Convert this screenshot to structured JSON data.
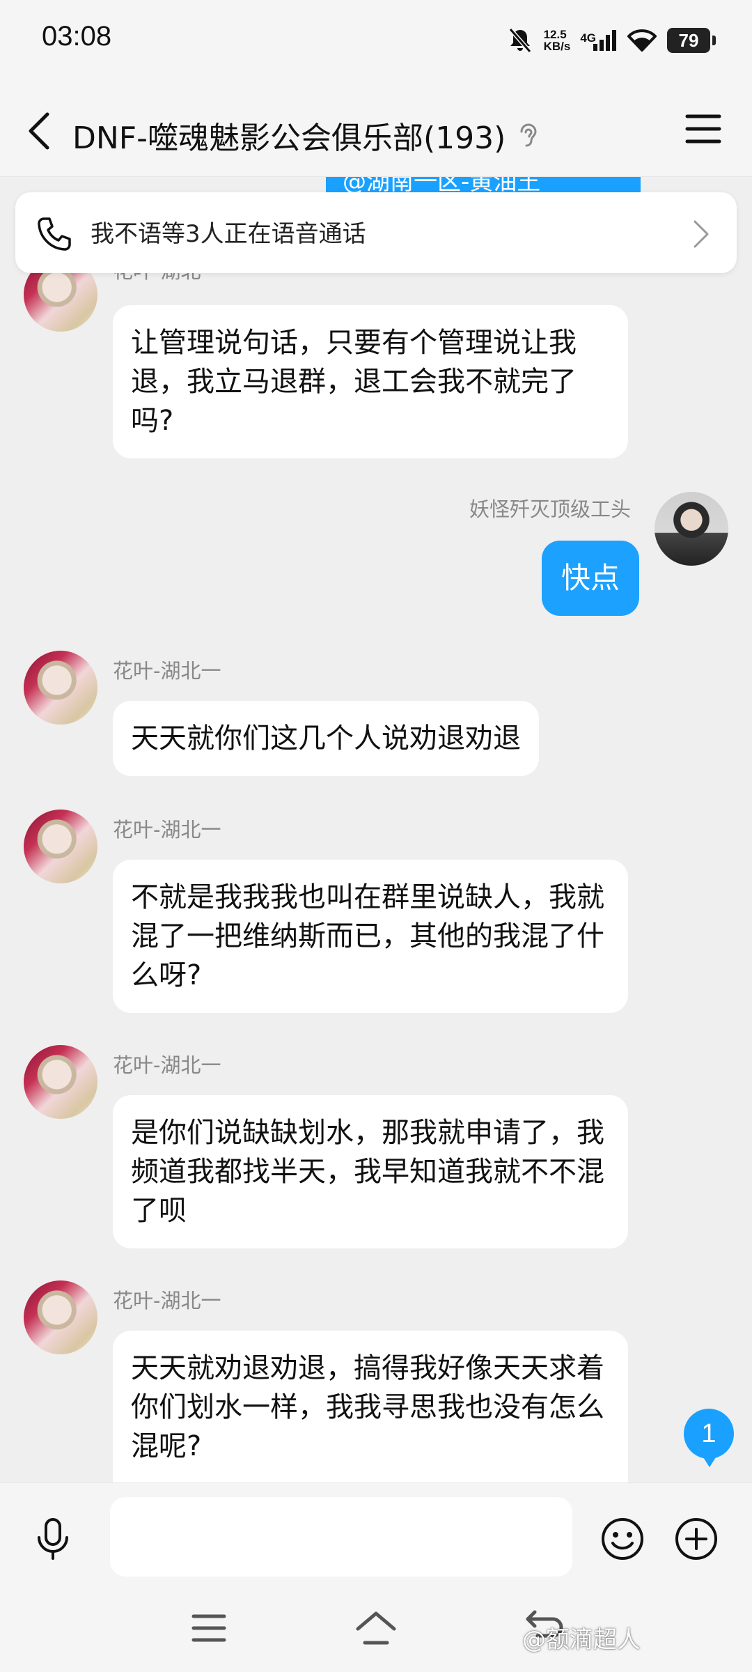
{
  "status_bar": {
    "time": "03:08",
    "speed_value": "12.5",
    "speed_unit": "KB/s",
    "network": "4G",
    "battery": "79"
  },
  "header": {
    "title": "DNF-噬魂魅影公会俱乐部(193)",
    "icons": [
      "back-arrow-icon",
      "ear-icon",
      "menu-icon"
    ]
  },
  "mention_strip": {
    "text": "@湖南一区-黄油王"
  },
  "call_banner": {
    "text": "我不语等3人正在语音通话"
  },
  "messages": [
    {
      "sender": "花叶-湖北一",
      "text": "让管理说句话，只要有个管理说让我退，我立马退群，退工会我不就完了吗?",
      "self": false
    },
    {
      "sender": "妖怪歼灭顶级工头",
      "text": "快点",
      "self": true
    },
    {
      "sender": "花叶-湖北一",
      "text": "天天就你们这几个人说劝退劝退",
      "self": false
    },
    {
      "sender": "花叶-湖北一",
      "text": "不就是我我我也叫在群里说缺人，我就混了一把维纳斯而已，其他的我混了什么呀?",
      "self": false
    },
    {
      "sender": "花叶-湖北一",
      "text": "是你们说缺缺划水，那我就申请了，我频道我都找半天，我早知道我就不不混了呗",
      "self": false
    },
    {
      "sender": "花叶-湖北一",
      "text": "天天就劝退劝退，搞得我好像天天求着你们划水一样，我我寻思我也没有怎么混呢?",
      "self": false
    }
  ],
  "unread_badge": "1",
  "input_bar": {
    "value": "",
    "icons": [
      "microphone-icon",
      "emoji-icon",
      "plus-icon"
    ]
  },
  "nav_bar": {
    "icons": [
      "nav-menu-icon",
      "nav-home-icon",
      "nav-back-icon"
    ]
  },
  "watermark": "@额滴超人",
  "colors": {
    "accent": "#1da1ff",
    "background": "#efefef",
    "bubble": "#ffffff"
  }
}
